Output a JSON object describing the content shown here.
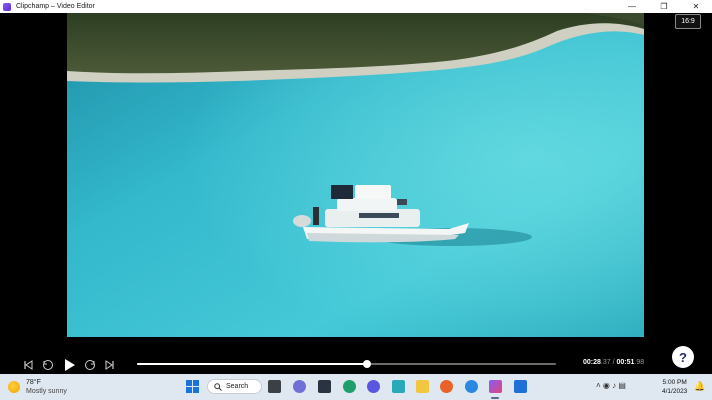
{
  "window": {
    "title": "Clipchamp – Video Editor",
    "controls": [
      "—",
      "❐",
      "✕"
    ]
  },
  "player": {
    "aspect_ratio": "16:9",
    "current_time_main": "00:28",
    "current_time_frac": ".37",
    "separator": " / ",
    "total_time_main": "00:51",
    "total_time_frac": ".98",
    "progress_fraction": 0.55,
    "help_label": "?"
  },
  "taskbar": {
    "weather_temp": "78°F",
    "weather_desc": "Mostly sunny",
    "search_label": "Search",
    "time": "5:00 PM",
    "date": "4/1/2023",
    "tray_glyphs": "˄  ◉ ♪ ▤",
    "pinned_icons": [
      "windows-start-icon",
      "task-view-icon",
      "chat-icon",
      "file-explorer-icon",
      "edge-icon",
      "cortana-icon",
      "store-icon",
      "folder-icon",
      "firefox-icon",
      "photos-icon",
      "clipchamp-icon",
      "editor-icon"
    ]
  }
}
